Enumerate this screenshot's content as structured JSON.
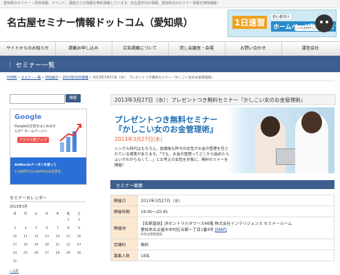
{
  "top_tagline": "愛知県のセミナー・研修情報、イベント、講座などの情報を無料掲載しています。名古屋市内の情報、愛知県内のセミナー情報を随時掲載！",
  "site_title": "名古屋セミナー情報ドットコム（愛知県）",
  "banner": {
    "headline": "1日速習",
    "sub": "初心者向け",
    "main": "ホームページ制作セミナー",
    "bubble": "いつもお待ちしております"
  },
  "nav": [
    {
      "label": "サイトからのお知らせ"
    },
    {
      "label": "掲載お申し込み"
    },
    {
      "label": "広告掲載について"
    },
    {
      "label": "貸し会議室・会場"
    },
    {
      "label": "お問い合わせ"
    },
    {
      "label": "運営会社"
    }
  ],
  "hero_title": "｜ セミナー一覧",
  "breadcrumbs": {
    "home": "HOME",
    "sep": " » ",
    "cat": "セミナー一覧",
    "month": "月別表示",
    "date": "2013年03月開催",
    "current": "2013年3月27日（水）：プレゼントつき無料セミナー『かしこい女のお金管理術』"
  },
  "sidebar": {
    "search_button": "検索",
    "google_ad": {
      "logo": "Google",
      "text": "Googleの広告をはじめませんか？ホームページへ",
      "tag": "アクセス数アップ",
      "blue_line1": "AdWordsクーポンを使って",
      "blue_line2": "2,500円で10,000円分の広告を。"
    },
    "calendar": {
      "title": "セミナーカレンダー",
      "month": "2013年3月",
      "weekdays": [
        "日",
        "月",
        "火",
        "水",
        "木",
        "金",
        "土"
      ],
      "rows": [
        [
          "",
          "",
          "",
          "",
          "",
          "1",
          "2"
        ],
        [
          "3",
          "4",
          "5",
          "6",
          "7",
          "8",
          "9"
        ],
        [
          "10",
          "11",
          "12",
          "13",
          "14",
          "15",
          "16"
        ],
        [
          "17",
          "18",
          "19",
          "20",
          "21",
          "22",
          "23"
        ],
        [
          "24",
          "25",
          "26",
          "27",
          "28",
          "29",
          "30"
        ],
        [
          "31",
          "",
          "",
          "",
          "",
          "",
          ""
        ]
      ],
      "prev_link": "« 2月"
    }
  },
  "post": {
    "title": "2013年3月27日（水）：プレゼントつき無料セミナー『かしこい女のお金管理術』",
    "hero": {
      "line1": "プレゼントつき無料セミナー",
      "line2": "『かしこい女のお金管理術』",
      "date": "2013年3月27日(水)",
      "paragraph": "シングル時代はもちろん、結婚後も昨今の女性がお金の管理を任されている現実があります。「でも、お金の管理ってどこから始めたらよいかわからなくて…」とお考えの女性を対象に、無料セミナーを開催！"
    },
    "section_title": "セミナー概要",
    "table": [
      {
        "label": "開催日",
        "value": "2013年3月27日（水）"
      },
      {
        "label": "開催時間",
        "value": "19:00～20:45"
      },
      {
        "label": "開催地",
        "value": "【名駅直結】JRセントラルタワーズ46階 株式会社インテリジェンス セミナールーム",
        "value2": "愛知県名古屋市中村区名駅一丁目1番4号",
        "map": "[MAP]",
        "value3": "JR名古屋駅直結"
      },
      {
        "label": "受講料",
        "value": "無料"
      },
      {
        "label": "募集人数",
        "value": "18名"
      }
    ]
  }
}
